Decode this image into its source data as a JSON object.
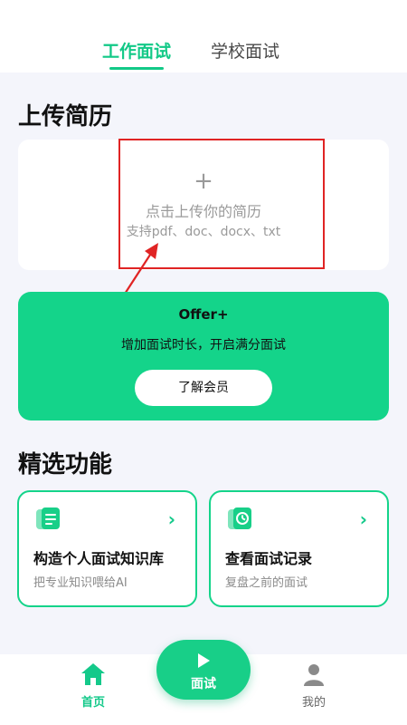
{
  "tabs": [
    {
      "label": "工作面试",
      "active": true
    },
    {
      "label": "学校面试",
      "active": false
    }
  ],
  "upload_section": {
    "title": "上传简历",
    "plus": "+",
    "main_text": "点击上传你的简历",
    "sub_text": "支持pdf、doc、docx、txt"
  },
  "offer": {
    "title": "Offer+",
    "description": "增加面试时长，开启满分面试",
    "button_label": "了解会员"
  },
  "features_section": {
    "title": "精选功能",
    "cards": [
      {
        "title": "构造个人面试知识库",
        "description": "把专业知识喂给AI",
        "icon": "document-icon"
      },
      {
        "title": "查看面试记录",
        "description": "复盘之前的面试",
        "icon": "clock-icon"
      }
    ]
  },
  "bottom_nav": {
    "home_label": "首页",
    "interview_label": "面试",
    "mine_label": "我的"
  },
  "colors": {
    "accent": "#14d48a",
    "annotation_red": "#e02424"
  }
}
